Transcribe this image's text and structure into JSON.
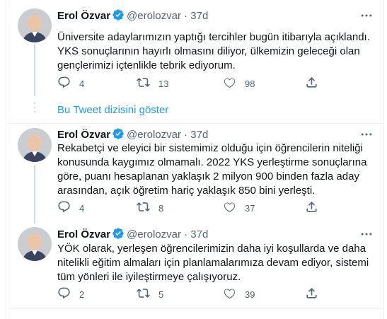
{
  "author": {
    "name": "Erol Özvar",
    "handle": "@erolozvar",
    "dot": "·",
    "time": "37d"
  },
  "thread_link": "Bu Tweet dizisini göster",
  "tweets": [
    {
      "text": "Üniversite adaylarımızın yaptığı tercihler bugün itibarıyla açıklandı. YKS sonuçlarının hayırlı olmasını diliyor, ülkemizin geleceği olan gençlerimizi içtenlikle tebrik ediyorum.",
      "replies": "4",
      "retweets": "13",
      "likes": "98"
    },
    {
      "text": "Rekabetçi ve eleyici bir sistemimiz olduğu için öğrencilerin niteliği konusunda kaygımız olmamalı. 2022 YKS yerleştirme sonuçlarına göre, puanı hesaplanan yaklaşık 2 milyon 900 binden fazla aday arasından, açık öğretim hariç yaklaşık 850 bini yerleşti.",
      "replies": "4",
      "retweets": "8",
      "likes": "37"
    },
    {
      "text": "YÖK olarak, yerleşen öğrencilerimizin daha iyi koşullarda ve daha nitelikli eğitim almaları için planlamalarımıza devam ediyor, sistemi tüm yönleri ile iyileştirmeye çalışıyoruz.",
      "replies": "2",
      "retweets": "5",
      "likes": "39"
    }
  ],
  "icons": {
    "verified": "verified-badge-icon",
    "more": "more-horizontal-icon",
    "reply": "reply-icon",
    "retweet": "retweet-icon",
    "like": "like-icon",
    "share": "share-icon"
  },
  "colors": {
    "accent": "#1d9bf0",
    "secondary_text": "#536471",
    "primary_text": "#0f1419",
    "thread_line": "#cfd9de"
  }
}
